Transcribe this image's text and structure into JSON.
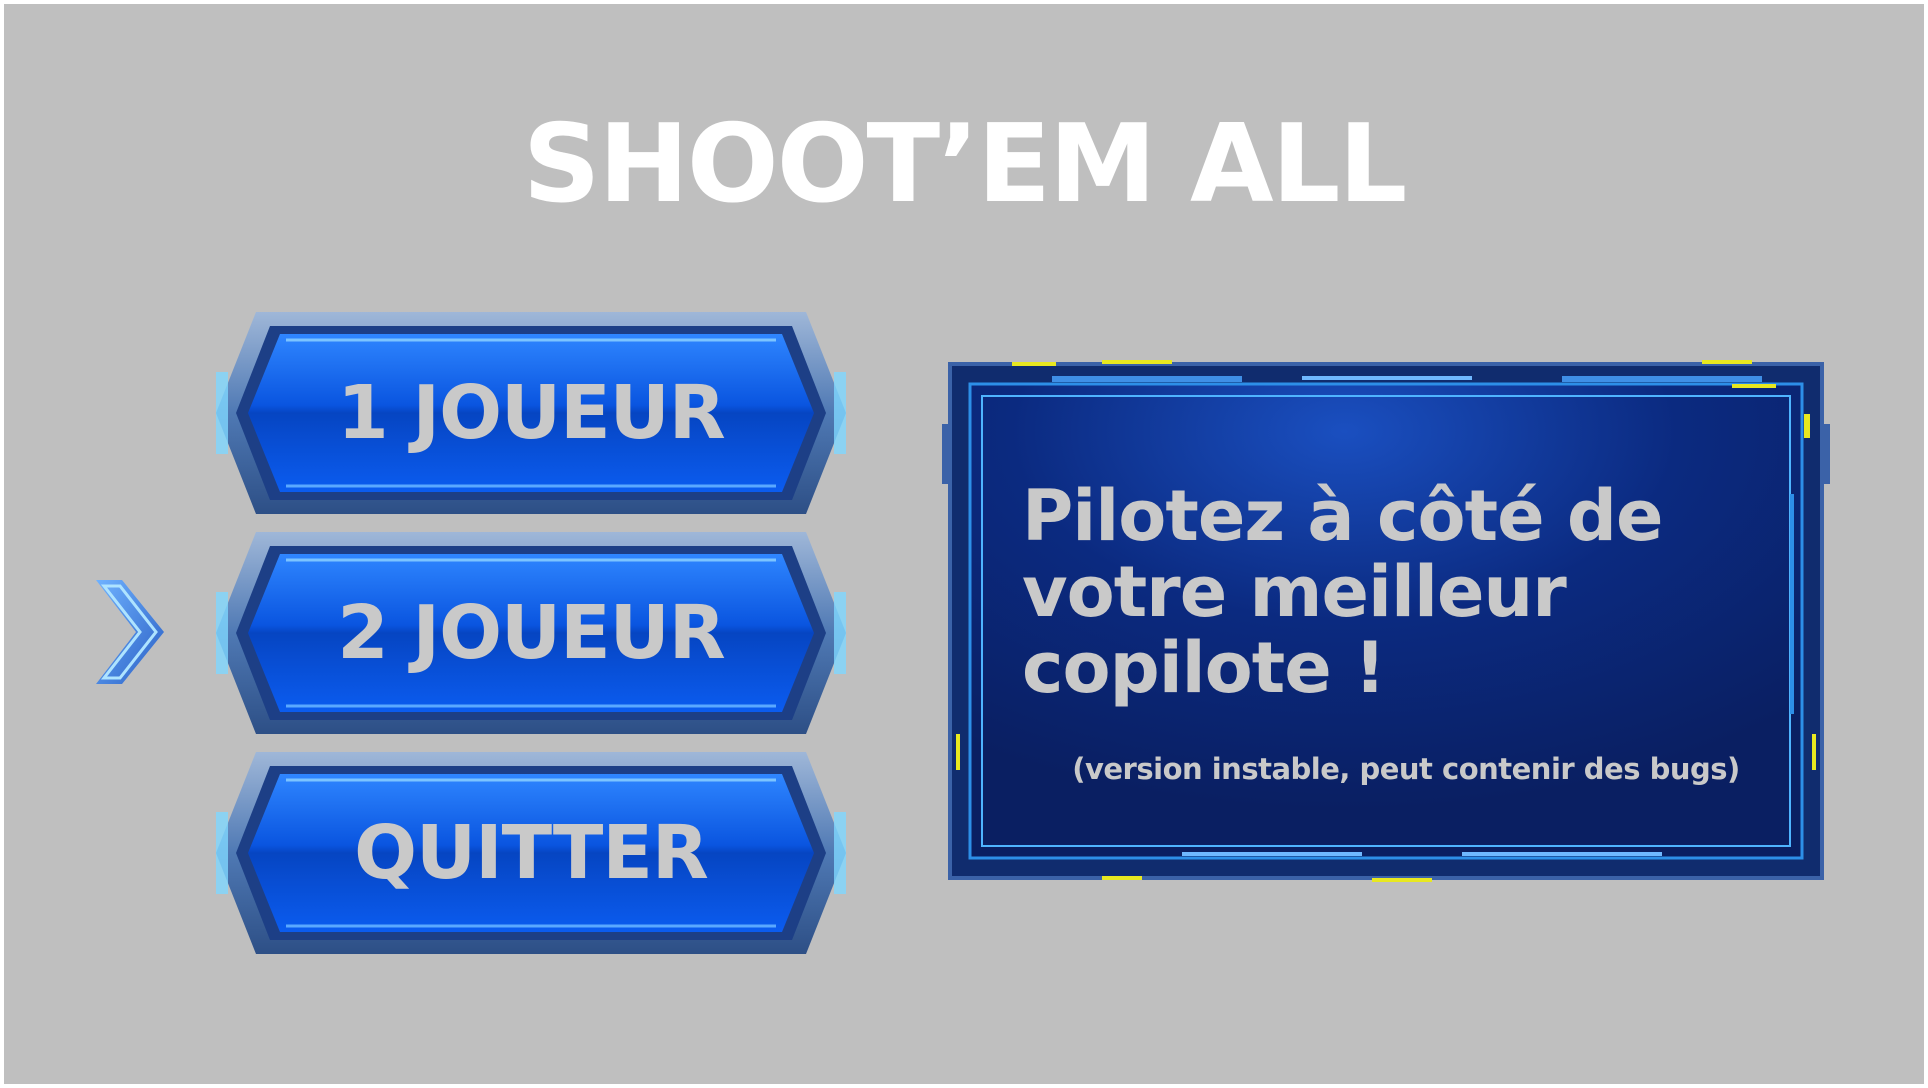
{
  "title": "SHOOT’EM ALL",
  "menu": {
    "items": [
      {
        "label": "1 JOUEUR",
        "selected": false
      },
      {
        "label": "2 JOUEUR",
        "selected": true
      },
      {
        "label": "QUITTER",
        "selected": false
      }
    ]
  },
  "info_panel": {
    "heading": "Pilotez à côté de votre meilleur copilote !",
    "note": "(version instable, peut contenir des bugs)"
  },
  "colors": {
    "background": "#bfbfbf",
    "title": "#ffffff",
    "button_blue": "#0a55e0",
    "panel_navy": "#0b2470",
    "label_gray": "#c9c9c9",
    "accent_yellow": "#e8e820"
  },
  "icons": {
    "selector": "chevron-right-icon"
  }
}
